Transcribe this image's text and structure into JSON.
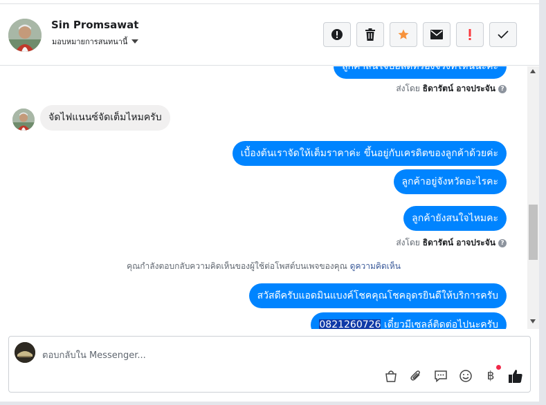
{
  "header": {
    "name": "Sin Promsawat",
    "assign_label": "มอบหมายการสนทนานี้",
    "actions": [
      {
        "icon": "alert-circle-icon"
      },
      {
        "icon": "trash-icon"
      },
      {
        "icon": "star-icon",
        "color": "#f7923b"
      },
      {
        "icon": "envelope-icon"
      },
      {
        "icon": "exclamation-icon",
        "color": "#fa383e"
      },
      {
        "icon": "check-icon"
      }
    ]
  },
  "thread": {
    "top_bubble": "ลูกค้าสนใจบ้อลัดทรองจริงที่ไหนนะคะ",
    "sent_by_1": {
      "prefix": "ส่งโดย",
      "name": "ธิดารัตน์ อาจประจัน"
    },
    "incoming_1": "จัดไฟแนนซ์จัดเต็มไหมครับ",
    "out_1": "เบื้องต้นเราจัดให้เต็มราคาค่ะ ขึ้นอยู่กับเครดิตของลูกค้าด้วยค่ะ",
    "out_2": "ลูกค้าอยู่จังหวัดอะไรคะ",
    "out_3": "ลูกค้ายังสนใจไหมคะ",
    "sent_by_2": {
      "prefix": "ส่งโดย",
      "name": "ธิดารัตน์ อาจประจัน"
    },
    "note_text": "คุณกำลังตอบกลับความคิดเห็นของผู้ใช้ต่อโพสต์บนเพจของคุณ",
    "note_link": "ดูความคิดเห็น",
    "out_4": "สวัสดีครับแอดมินแบงค์โชคคุณโชคอุดรยินดีให้บริการครับ",
    "out_5_highlight": "0821260726",
    "out_5_rest": " เดี๋ยวมีเซลล์ติดต่อไปนะครับ"
  },
  "composer": {
    "placeholder": "ตอบกลับใน Messenger...",
    "tools": [
      "bag-icon",
      "paperclip-icon",
      "chat-bubble-icon",
      "smiley-icon",
      "baht-icon",
      "thumbs-up-icon"
    ],
    "baht_symbol": "฿"
  },
  "colors": {
    "accent": "#0084ff",
    "link": "#385898",
    "notification": "#f02849"
  }
}
